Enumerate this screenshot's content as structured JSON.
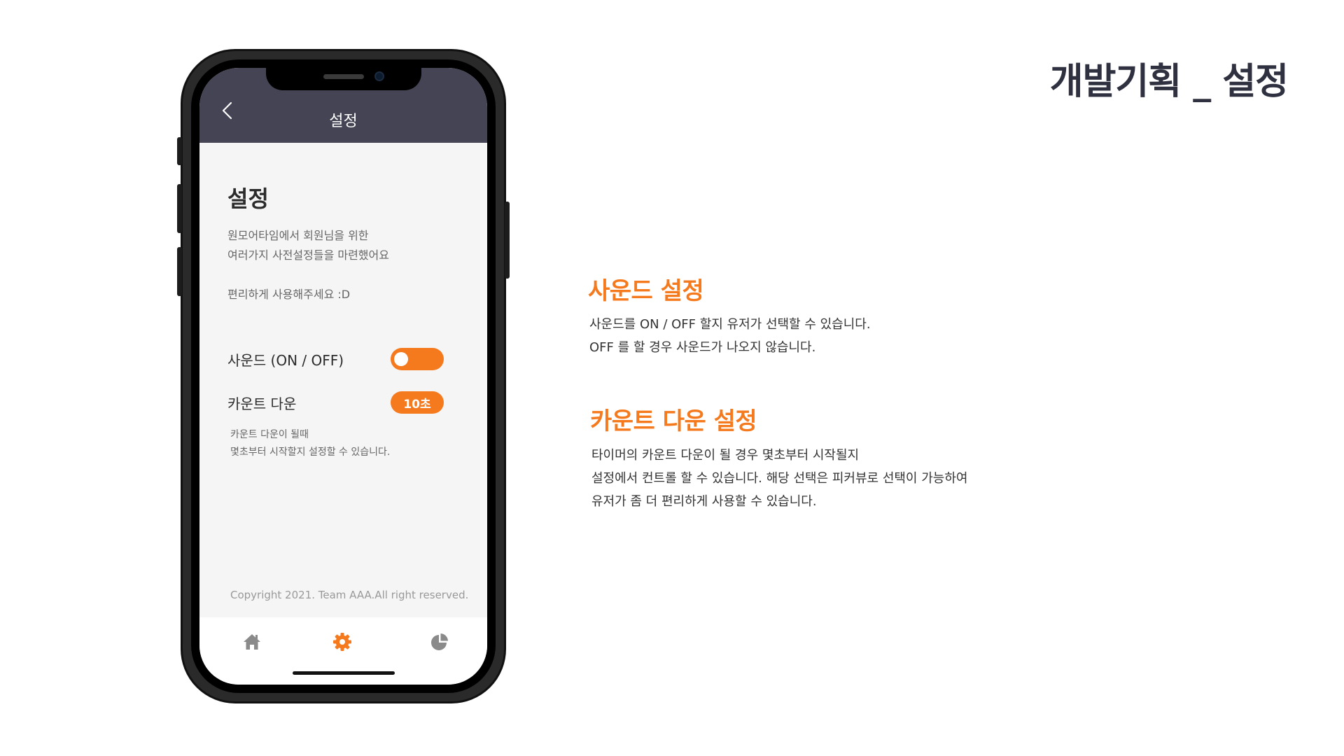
{
  "page": {
    "title": "개발기획 _ 설정"
  },
  "app": {
    "header_title": "설정",
    "heading": "설정",
    "intro_line1": "원모어타임에서 회원님을 위한",
    "intro_line2": "여러가지 사전설정들을 마련했어요",
    "intro_line3": "편리하게 사용해주세요 :D",
    "sound_label": "사운드 (ON / OFF)",
    "sound_state": "on",
    "countdown_label": "카운트 다운",
    "countdown_value": "10초",
    "countdown_desc_line1": "카운트 다운이 될때",
    "countdown_desc_line2": "몇초부터 시작할지 설정할 수 있습니다.",
    "copyright": "Copyright 2021. Team AAA.All right reserved.",
    "tabs": [
      {
        "icon": "home-icon",
        "active": false
      },
      {
        "icon": "gear-icon",
        "active": true
      },
      {
        "icon": "pie-chart-icon",
        "active": false
      }
    ]
  },
  "sound_section": {
    "title": "사운드 설정",
    "line1": "사운드를  ON / OFF 할지 유저가 선택할 수 있습니다.",
    "line2": "OFF 를 할 경우 사운드가 나오지 않습니다."
  },
  "countdown_section": {
    "title": "카운트 다운 설정",
    "line1": "타이머의 카운트 다운이 될 경우 몇초부터 시작될지",
    "line2": "설정에서 컨트롤 할 수 있습니다. 해당 선택은 피커뷰로 선택이 가능하여",
    "line3": "유저가 좀 더 편리하게 사용할 수 있습니다."
  },
  "colors": {
    "accent": "#f5791d",
    "header_bg": "#454454",
    "title": "#2f3140",
    "inactive_icon": "#8a8a8a"
  }
}
